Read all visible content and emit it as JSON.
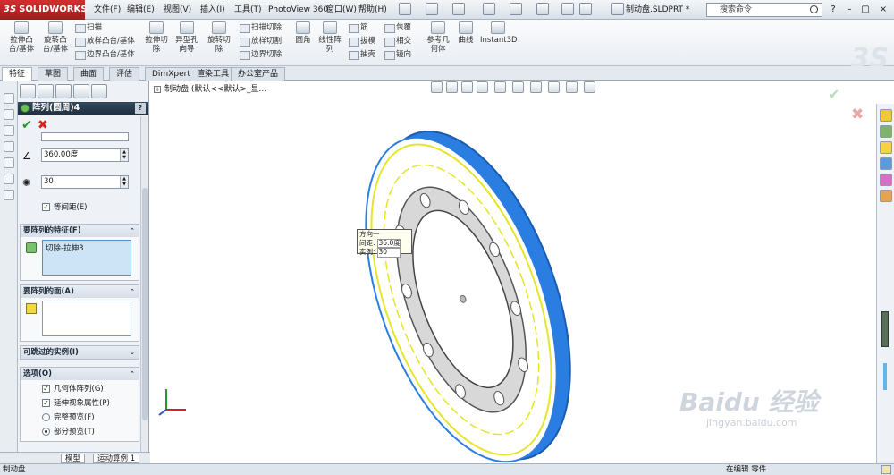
{
  "app": {
    "logo_text": "SOLIDWORKS",
    "menus": [
      "文件(F)",
      "编辑(E)",
      "视图(V)",
      "插入(I)",
      "工具(T)",
      "PhotoView 360",
      "窗口(W)",
      "帮助(H)"
    ],
    "document_title": "制动盘.SLDPRT *",
    "search_placeholder": "搜索命令"
  },
  "ribbon": {
    "big_buttons": [
      "拉伸凸台/基体",
      "旋转凸台/基体",
      "拉伸切除",
      "异型孔向导",
      "旋转切除",
      "圆角",
      "线性阵列",
      "参考几何体",
      "曲线",
      "Instant3D"
    ],
    "small_buttons": [
      "扫描",
      "放样凸台/基体",
      "边界凸台/基体",
      "扫描切除",
      "放样切割",
      "边界切除",
      "筋",
      "拔模",
      "抽壳",
      "包覆",
      "相交",
      "镜向"
    ]
  },
  "tabs": [
    "特征",
    "草图",
    "曲面",
    "评估",
    "DimXpert",
    "渲染工具",
    "办公室产品"
  ],
  "active_tab": "特征",
  "property_manager": {
    "title": "阵列(圆周)4",
    "help": "?",
    "angle_value": "360.00度",
    "count_value": "30",
    "equal_spacing_label": "等间距(E)",
    "features_section": "要阵列的特征(F)",
    "feature_item": "切除-拉伸3",
    "faces_section": "要阵列的面(A)",
    "skip_section": "可跳过的实例(I)",
    "options_section": "选项(O)",
    "options": [
      {
        "label": "几何体阵列(G)",
        "checked": true
      },
      {
        "label": "延伸视象属性(P)",
        "checked": true
      }
    ],
    "preview": [
      {
        "label": "完整预览(F)",
        "selected": false
      },
      {
        "label": "部分预览(T)",
        "selected": true
      }
    ]
  },
  "viewport": {
    "tree_label": "制动盘 (默认<<默认>_显...",
    "callout": {
      "header": "方向一",
      "spacing_label": "间距:",
      "spacing_value": "36.0度",
      "instances_label": "实例:",
      "instances_value": "30"
    }
  },
  "bottom_tabs": [
    "模型",
    "运动算例 1"
  ],
  "status": {
    "left": "制动盘",
    "right": "在编辑 零件"
  },
  "watermark": {
    "text": "Baidu 经验",
    "url": "jingyan.baidu.com"
  }
}
